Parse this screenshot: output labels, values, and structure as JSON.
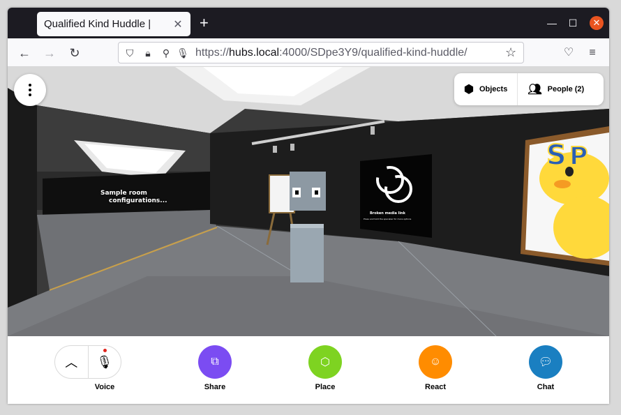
{
  "browser": {
    "tab_title": "Qualified Kind Huddle |",
    "tab_close": "✕",
    "new_tab": "+",
    "url_prefix": "https://",
    "url_host": "hubs.local",
    "url_rest": ":4000/SDpe3Y9/qualified-kind-huddle/"
  },
  "scene": {
    "room_sign_line1": "Sample room",
    "room_sign_line2": "configurations...",
    "broken_media_title": "Broken media link",
    "broken_media_sub": "Press and hold the spacebar for more options"
  },
  "top_panel": {
    "objects_label": "Objects",
    "people_label": "People (2)"
  },
  "bottom_bar": {
    "voice_label": "Voice",
    "share_label": "Share",
    "place_label": "Place",
    "react_label": "React",
    "chat_label": "Chat"
  },
  "colors": {
    "share": "#7b4cf2",
    "place": "#7ed321",
    "react": "#ff8c00",
    "chat": "#1a7fc1"
  }
}
